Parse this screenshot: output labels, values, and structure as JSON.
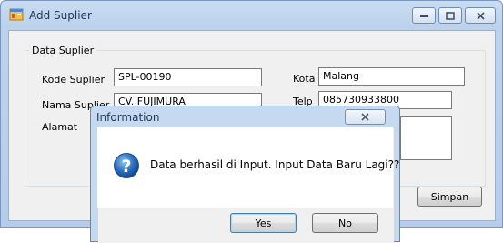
{
  "window": {
    "title": "Add Suplier",
    "controls": {
      "minimize": "minimize",
      "maximize": "maximize",
      "close": "close"
    }
  },
  "group": {
    "legend": "Data Suplier"
  },
  "form": {
    "kode_label": "Kode Suplier",
    "kode_value": "SPL-00190",
    "nama_label": "Nama Suplier",
    "nama_value": "CV. FUJIMURA",
    "alamat_label": "Alamat",
    "kota_label": "Kota",
    "kota_value": "Malang",
    "telp_label": "Telp",
    "telp_value": "085730933800",
    "save_label": "Simpan"
  },
  "dialog": {
    "title": "Information",
    "message": "Data berhasil di Input. Input Data Baru Lagi??",
    "icon": "question-icon",
    "yes_label": "Yes",
    "no_label": "No"
  },
  "colors": {
    "title_bar": "#c9dcf1",
    "window_bg": "#f0f0f0",
    "dialog_frame": "#c5d9f1",
    "question_icon": "#2c6fbf"
  }
}
